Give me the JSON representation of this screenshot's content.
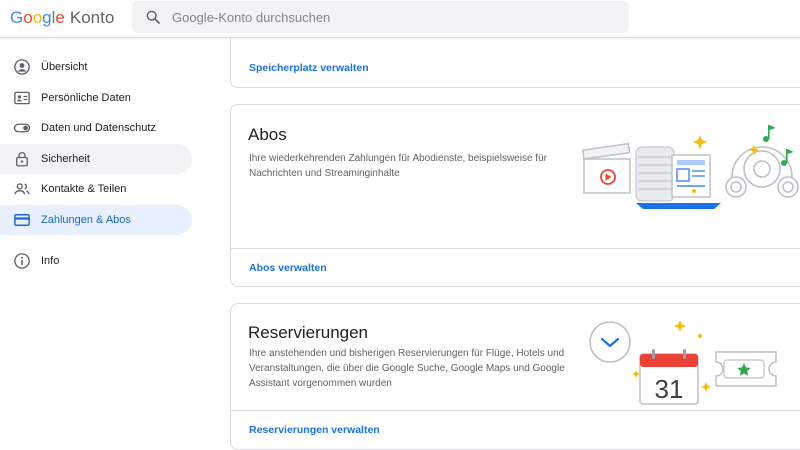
{
  "header": {
    "logo_letters": [
      "G",
      "o",
      "o",
      "g",
      "l",
      "e"
    ],
    "app_name": "Konto",
    "search_placeholder": "Google-Konto durchsuchen"
  },
  "sidebar": {
    "items": [
      {
        "label": "Übersicht",
        "icon": "account-circle-icon"
      },
      {
        "label": "Persönliche Daten",
        "icon": "id-card-icon"
      },
      {
        "label": "Daten und Datenschutz",
        "icon": "toggle-icon"
      },
      {
        "label": "Sicherheit",
        "icon": "lock-icon"
      },
      {
        "label": "Kontakte & Teilen",
        "icon": "people-icon"
      },
      {
        "label": "Zahlungen & Abos",
        "icon": "credit-card-icon"
      },
      {
        "label": "Info",
        "icon": "info-icon"
      }
    ],
    "active_index": 5,
    "hover_index": 3
  },
  "cards": {
    "storage": {
      "link": "Speicherplatz verwalten"
    },
    "abos": {
      "title": "Abos",
      "description": "Ihre wiederkehrenden Zahlungen für Abodienste, beispielsweise für Nachrichten und Streaminginhalte",
      "link": "Abos verwalten"
    },
    "reservierungen": {
      "title": "Reservierungen",
      "description": "Ihre anstehenden und bisherigen Reservierungen für Flüge, Hotels und Veranstaltungen, die über die Google Suche, Google Maps und Google Assistant vorgenommen wurden",
      "link": "Reservierungen verwalten",
      "calendar_day": "31"
    }
  },
  "colors": {
    "accent": "#1a73e8",
    "active_bg": "#e8f0fe",
    "hover_bg": "#f1f3f4",
    "border": "#dadce0"
  }
}
